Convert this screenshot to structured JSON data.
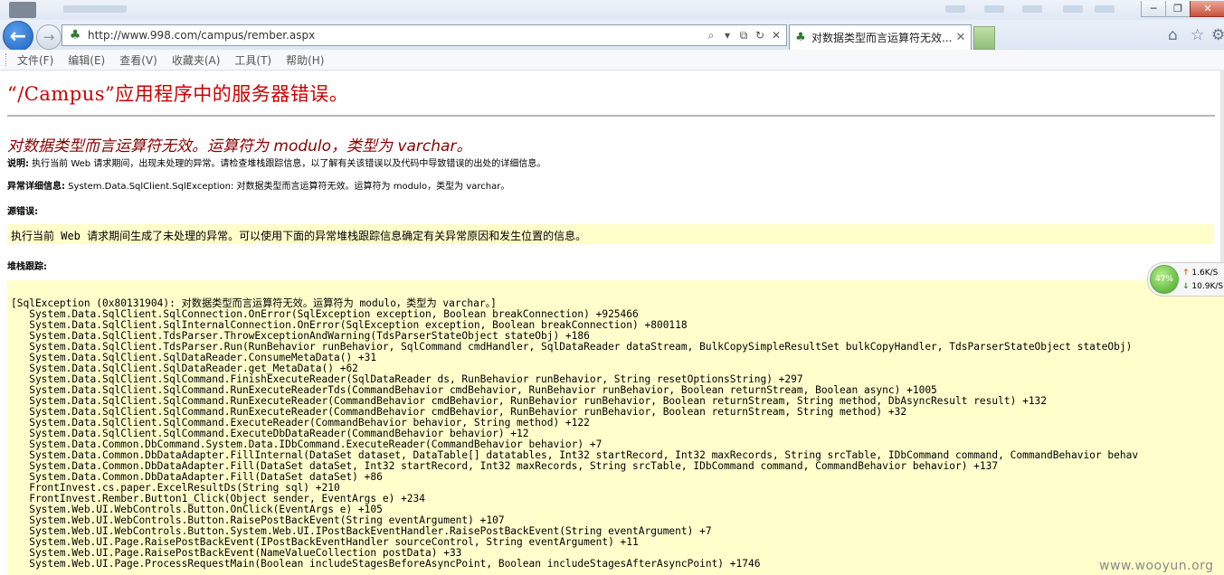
{
  "browser": {
    "address_url": "http://www.998.com/campus/rember.aspx",
    "tab_title": "对数据类型而言运算符无效...",
    "menu": [
      "文件(F)",
      "编辑(E)",
      "查看(V)",
      "收藏夹(A)",
      "工具(T)",
      "帮助(H)"
    ]
  },
  "page": {
    "title": "“/Campus”应用程序中的服务器错误。",
    "error_heading": "对数据类型而言运算符无效。运算符为 modulo，类型为 varchar。",
    "description_label": "说明:",
    "description_text": " 执行当前 Web 请求期间，出现未处理的异常。请检查堆栈跟踪信息，以了解有关该错误以及代码中导致错误的出处的详细信息。",
    "exception_label": "异常详细信息:",
    "exception_text": " System.Data.SqlClient.SqlException: 对数据类型而言运算符无效。运算符为 modulo，类型为 varchar。",
    "source_error_label": "源错误:",
    "source_error_text": "执行当前 Web 请求期间生成了未处理的异常。可以使用下面的异常堆栈跟踪信息确定有关异常原因和发生位置的信息。",
    "stack_trace_label": "堆栈跟踪:",
    "stack_trace": [
      "[SqlException (0x80131904): 对数据类型而言运算符无效。运算符为 modulo，类型为 varchar。]",
      "   System.Data.SqlClient.SqlConnection.OnError(SqlException exception, Boolean breakConnection) +925466",
      "   System.Data.SqlClient.SqlInternalConnection.OnError(SqlException exception, Boolean breakConnection) +800118",
      "   System.Data.SqlClient.TdsParser.ThrowExceptionAndWarning(TdsParserStateObject stateObj) +186",
      "   System.Data.SqlClient.TdsParser.Run(RunBehavior runBehavior, SqlCommand cmdHandler, SqlDataReader dataStream, BulkCopySimpleResultSet bulkCopyHandler, TdsParserStateObject stateObj)",
      "   System.Data.SqlClient.SqlDataReader.ConsumeMetaData() +31",
      "   System.Data.SqlClient.SqlDataReader.get_MetaData() +62",
      "   System.Data.SqlClient.SqlCommand.FinishExecuteReader(SqlDataReader ds, RunBehavior runBehavior, String resetOptionsString) +297",
      "   System.Data.SqlClient.SqlCommand.RunExecuteReaderTds(CommandBehavior cmdBehavior, RunBehavior runBehavior, Boolean returnStream, Boolean async) +1005",
      "   System.Data.SqlClient.SqlCommand.RunExecuteReader(CommandBehavior cmdBehavior, RunBehavior runBehavior, Boolean returnStream, String method, DbAsyncResult result) +132",
      "   System.Data.SqlClient.SqlCommand.RunExecuteReader(CommandBehavior cmdBehavior, RunBehavior runBehavior, Boolean returnStream, String method) +32",
      "   System.Data.SqlClient.SqlCommand.ExecuteReader(CommandBehavior behavior, String method) +122",
      "   System.Data.SqlClient.SqlCommand.ExecuteDbDataReader(CommandBehavior behavior) +12",
      "   System.Data.Common.DbCommand.System.Data.IDbCommand.ExecuteReader(CommandBehavior behavior) +7",
      "   System.Data.Common.DbDataAdapter.FillInternal(DataSet dataset, DataTable[] datatables, Int32 startRecord, Int32 maxRecords, String srcTable, IDbCommand command, CommandBehavior behav",
      "   System.Data.Common.DbDataAdapter.Fill(DataSet dataSet, Int32 startRecord, Int32 maxRecords, String srcTable, IDbCommand command, CommandBehavior behavior) +137",
      "   System.Data.Common.DbDataAdapter.Fill(DataSet dataSet) +86",
      "   FrontInvest.cs.paper.ExcelResultDs(String sql) +210",
      "   FrontInvest.Rember.Button1_Click(Object sender, EventArgs e) +234",
      "   System.Web.UI.WebControls.Button.OnClick(EventArgs e) +105",
      "   System.Web.UI.WebControls.Button.RaisePostBackEvent(String eventArgument) +107",
      "   System.Web.UI.WebControls.Button.System.Web.UI.IPostBackEventHandler.RaisePostBackEvent(String eventArgument) +7",
      "   System.Web.UI.Page.RaisePostBackEvent(IPostBackEventHandler sourceControl, String eventArgument) +11",
      "   System.Web.UI.Page.RaisePostBackEvent(NameValueCollection postData) +33",
      "   System.Web.UI.Page.ProcessRequestMain(Boolean includeStagesBeforeAsyncPoint, Boolean includeStagesAfterAsyncPoint) +1746"
    ]
  },
  "net_widget": {
    "percent": "47%",
    "upload": "1.6K/S",
    "download": "10.9K/S"
  },
  "watermark": "www.wooyun.org"
}
